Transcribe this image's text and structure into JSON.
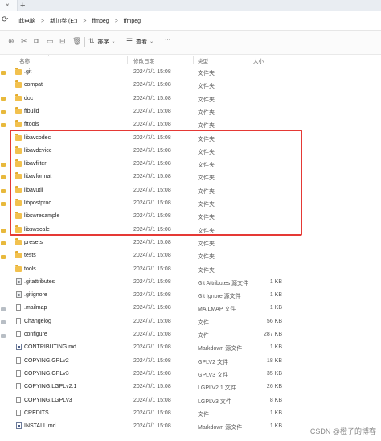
{
  "tabbar": {
    "close_glyph": "×",
    "new_tab_glyph": "+"
  },
  "address": {
    "refresh_icon": "refresh-icon",
    "crumbs": [
      "此电脑",
      "新加卷 (E:)",
      "ffmpeg",
      "ffmpeg"
    ],
    "separator": ">"
  },
  "toolbar": {
    "sort_label": "排序",
    "view_label": "查看",
    "more_label": "···"
  },
  "columns": {
    "name": "名称",
    "date": "修改日期",
    "type": "类型",
    "size": "大小"
  },
  "rows": [
    {
      "name": ".git",
      "date": "2024/7/1 15:08",
      "type": "文件夹",
      "size": "",
      "icon": "folder"
    },
    {
      "name": "compat",
      "date": "2024/7/1 15:08",
      "type": "文件夹",
      "size": "",
      "icon": "folder"
    },
    {
      "name": "doc",
      "date": "2024/7/1 15:08",
      "type": "文件夹",
      "size": "",
      "icon": "folder"
    },
    {
      "name": "ffbuild",
      "date": "2024/7/1 15:08",
      "type": "文件夹",
      "size": "",
      "icon": "folder"
    },
    {
      "name": "fftools",
      "date": "2024/7/1 15:08",
      "type": "文件夹",
      "size": "",
      "icon": "folder"
    },
    {
      "name": "libavcodec",
      "date": "2024/7/1 15:08",
      "type": "文件夹",
      "size": "",
      "icon": "folder"
    },
    {
      "name": "libavdevice",
      "date": "2024/7/1 15:08",
      "type": "文件夹",
      "size": "",
      "icon": "folder"
    },
    {
      "name": "libavfilter",
      "date": "2024/7/1 15:08",
      "type": "文件夹",
      "size": "",
      "icon": "folder"
    },
    {
      "name": "libavformat",
      "date": "2024/7/1 15:08",
      "type": "文件夹",
      "size": "",
      "icon": "folder"
    },
    {
      "name": "libavutil",
      "date": "2024/7/1 15:08",
      "type": "文件夹",
      "size": "",
      "icon": "folder"
    },
    {
      "name": "libpostproc",
      "date": "2024/7/1 15:08",
      "type": "文件夹",
      "size": "",
      "icon": "folder"
    },
    {
      "name": "libswresample",
      "date": "2024/7/1 15:08",
      "type": "文件夹",
      "size": "",
      "icon": "folder"
    },
    {
      "name": "libswscale",
      "date": "2024/7/1 15:08",
      "type": "文件夹",
      "size": "",
      "icon": "folder"
    },
    {
      "name": "presets",
      "date": "2024/7/1 15:08",
      "type": "文件夹",
      "size": "",
      "icon": "folder"
    },
    {
      "name": "tests",
      "date": "2024/7/1 15:08",
      "type": "文件夹",
      "size": "",
      "icon": "folder"
    },
    {
      "name": "tools",
      "date": "2024/7/1 15:08",
      "type": "文件夹",
      "size": "",
      "icon": "folder"
    },
    {
      "name": ".gitattributes",
      "date": "2024/7/1 15:08",
      "type": "Git Attributes 源文件",
      "size": "1 KB",
      "icon": "gear"
    },
    {
      "name": ".gitignore",
      "date": "2024/7/1 15:08",
      "type": "Git Ignore 源文件",
      "size": "1 KB",
      "icon": "gear"
    },
    {
      "name": ".mailmap",
      "date": "2024/7/1 15:08",
      "type": "MAILMAP 文件",
      "size": "1 KB",
      "icon": "file"
    },
    {
      "name": "Changelog",
      "date": "2024/7/1 15:08",
      "type": "文件",
      "size": "56 KB",
      "icon": "file"
    },
    {
      "name": "configure",
      "date": "2024/7/1 15:08",
      "type": "文件",
      "size": "287 KB",
      "icon": "file"
    },
    {
      "name": "CONTRIBUTING.md",
      "date": "2024/7/1 15:08",
      "type": "Markdown 源文件",
      "size": "1 KB",
      "icon": "md"
    },
    {
      "name": "COPYING.GPLv2",
      "date": "2024/7/1 15:08",
      "type": "GPLV2 文件",
      "size": "18 KB",
      "icon": "file"
    },
    {
      "name": "COPYING.GPLv3",
      "date": "2024/7/1 15:08",
      "type": "GPLV3 文件",
      "size": "35 KB",
      "icon": "file"
    },
    {
      "name": "COPYING.LGPLv2.1",
      "date": "2024/7/1 15:08",
      "type": "LGPLV2.1 文件",
      "size": "26 KB",
      "icon": "file"
    },
    {
      "name": "COPYING.LGPLv3",
      "date": "2024/7/1 15:08",
      "type": "LGPLV3 文件",
      "size": "8 KB",
      "icon": "file"
    },
    {
      "name": "CREDITS",
      "date": "2024/7/1 15:08",
      "type": "文件",
      "size": "1 KB",
      "icon": "file"
    },
    {
      "name": "INSTALL.md",
      "date": "2024/7/1 15:08",
      "type": "Markdown 源文件",
      "size": "1 KB",
      "icon": "md"
    }
  ],
  "highlight_color": "#e53935",
  "watermark": "CSDN @橙子的博客"
}
